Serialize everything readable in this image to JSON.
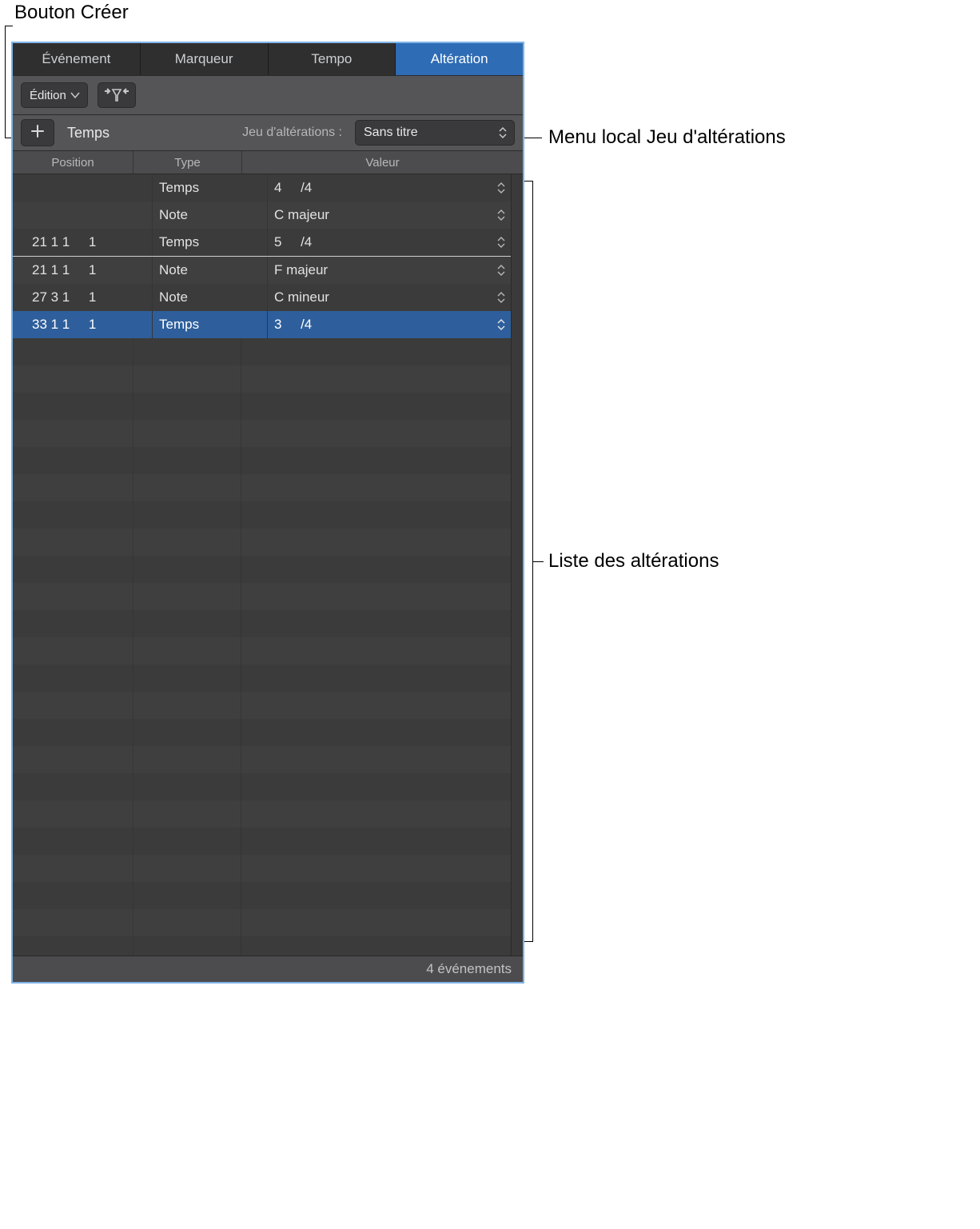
{
  "callouts": {
    "create_button": "Bouton Créer",
    "signature_set_menu": "Menu local Jeu d'altérations",
    "signature_list": "Liste des altérations"
  },
  "tabs": {
    "items": [
      {
        "label": "Événement"
      },
      {
        "label": "Marqueur"
      },
      {
        "label": "Tempo"
      },
      {
        "label": "Altération"
      }
    ],
    "selected_index": 3
  },
  "toolbar": {
    "edit_label": "Édition"
  },
  "subtoolbar": {
    "mode_label": "Temps",
    "dropdown_label": "Jeu d'altérations :",
    "dropdown_value": "Sans titre"
  },
  "columns": {
    "position": "Position",
    "type": "Type",
    "value": "Valeur"
  },
  "rows": [
    {
      "position": "",
      "sub": "",
      "type": "Temps",
      "value": "4     /4",
      "has_stepper": true,
      "divider": false,
      "selected": false
    },
    {
      "position": "",
      "sub": "",
      "type": "Note",
      "value": "C majeur",
      "has_stepper": true,
      "divider": false,
      "selected": false
    },
    {
      "position": "21 1 1     1",
      "sub": "",
      "type": "Temps",
      "value": "5     /4",
      "has_stepper": true,
      "divider": true,
      "selected": false
    },
    {
      "position": "21 1 1     1",
      "sub": "",
      "type": "Note",
      "value": "F majeur",
      "has_stepper": true,
      "divider": false,
      "selected": false
    },
    {
      "position": "27 3 1     1",
      "sub": "",
      "type": "Note",
      "value": "C mineur",
      "has_stepper": true,
      "divider": false,
      "selected": false
    },
    {
      "position": "33 1 1     1",
      "sub": "",
      "type": "Temps",
      "value": "3     /4",
      "has_stepper": true,
      "divider": false,
      "selected": true
    }
  ],
  "footer": {
    "status": "4 événements"
  }
}
